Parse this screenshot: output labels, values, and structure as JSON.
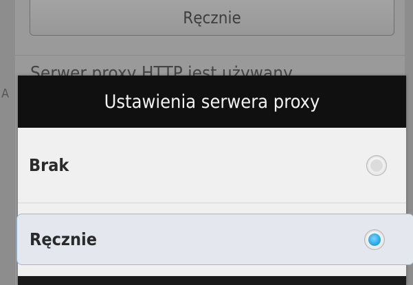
{
  "background": {
    "manual_button_label": "Ręcznie",
    "peek_text": "Serwer proxy HTTP jest używany",
    "left_glyph_a": "A",
    "colors": {
      "dim_overlay": "#9a9a9a"
    }
  },
  "dialog": {
    "title": "Ustawienia serwera proxy",
    "options": [
      {
        "label": "Brak",
        "selected": false
      },
      {
        "label": "Ręcznie",
        "selected": true
      }
    ],
    "colors": {
      "header_bg": "#101010",
      "body_bg": "#f0f0f0",
      "selected_bg": "#e4e8ee",
      "radio_selected": "#27a8e8"
    }
  }
}
